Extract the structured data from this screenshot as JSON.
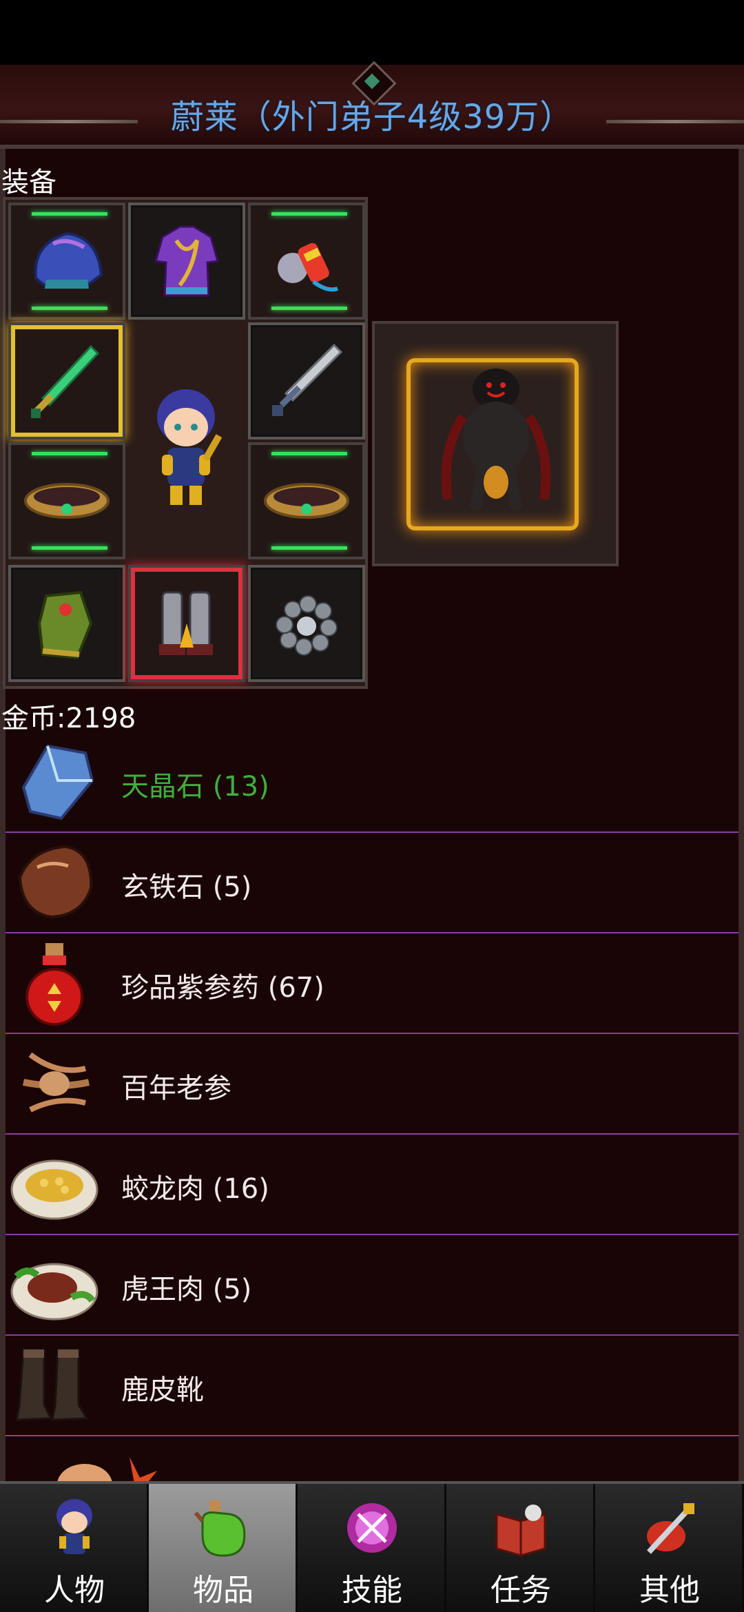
{
  "header": {
    "title": "蔚莱（外门弟子4级39万）"
  },
  "equipment": {
    "section_label": "装备"
  },
  "gold": {
    "label": "金币:2198"
  },
  "inventory": {
    "items": [
      {
        "name": "天晶石 (13)",
        "highlight": true,
        "icon": "crystal-icon"
      },
      {
        "name": "玄铁石 (5)",
        "icon": "ore-stone-icon"
      },
      {
        "name": "珍品紫参药 (67)",
        "icon": "potion-icon"
      },
      {
        "name": "百年老参",
        "icon": "ginseng-icon"
      },
      {
        "name": "蛟龙肉 (16)",
        "icon": "dish-icon"
      },
      {
        "name": "虎王肉 (5)",
        "icon": "steak-icon"
      },
      {
        "name": "鹿皮靴",
        "icon": "boots-icon"
      }
    ]
  },
  "tabs": [
    {
      "label": "人物",
      "icon": "character-icon",
      "active": false
    },
    {
      "label": "物品",
      "icon": "potion-bag-icon",
      "active": true
    },
    {
      "label": "技能",
      "icon": "skill-orb-icon",
      "active": false
    },
    {
      "label": "任务",
      "icon": "quest-book-icon",
      "active": false
    },
    {
      "label": "其他",
      "icon": "sword-shield-icon",
      "active": false
    }
  ],
  "colors": {
    "title": "#67a7e6",
    "highlight_item": "#3fae3c",
    "divider": "#8e3ca0",
    "panel_bg": "#1a0506"
  }
}
